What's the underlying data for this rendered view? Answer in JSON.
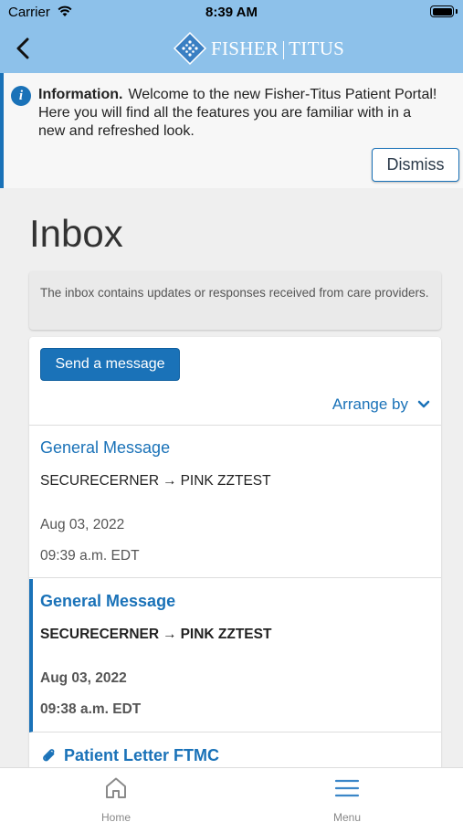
{
  "status_bar": {
    "carrier": "Carrier",
    "time": "8:39 AM"
  },
  "nav": {
    "back_icon": "chevron-left-icon",
    "logo_left": "FISHER",
    "logo_right": "TITUS",
    "bar_color": "#8dc1ea"
  },
  "info_banner": {
    "title": "Information.",
    "message": "Welcome to the new Fisher-Titus Patient Portal! Here you will find all the features you are familiar with in a new and refreshed look.",
    "dismiss_label": "Dismiss"
  },
  "page": {
    "title": "Inbox",
    "description": "The inbox contains updates or responses received from care providers."
  },
  "toolbar": {
    "send_label": "Send a message",
    "arrange_label": "Arrange by"
  },
  "messages": [
    {
      "subject": "General Message",
      "from": "SECURECERNER",
      "to": "PINK ZZTEST",
      "date": "Aug 03, 2022",
      "time": "09:39 a.m. EDT",
      "unread": false
    },
    {
      "subject": "General Message",
      "from": "SECURECERNER",
      "to": "PINK ZZTEST",
      "date": "Aug 03, 2022",
      "time": "09:38 a.m. EDT",
      "unread": true
    },
    {
      "subject": "Patient Letter FTMC",
      "has_attachment": true,
      "unread": true
    }
  ],
  "tabs": [
    {
      "label": "Home",
      "icon": "home-icon"
    },
    {
      "label": "Menu",
      "icon": "menu-icon"
    }
  ],
  "colors": {
    "accent": "#1a72b8",
    "background": "#efefef"
  }
}
